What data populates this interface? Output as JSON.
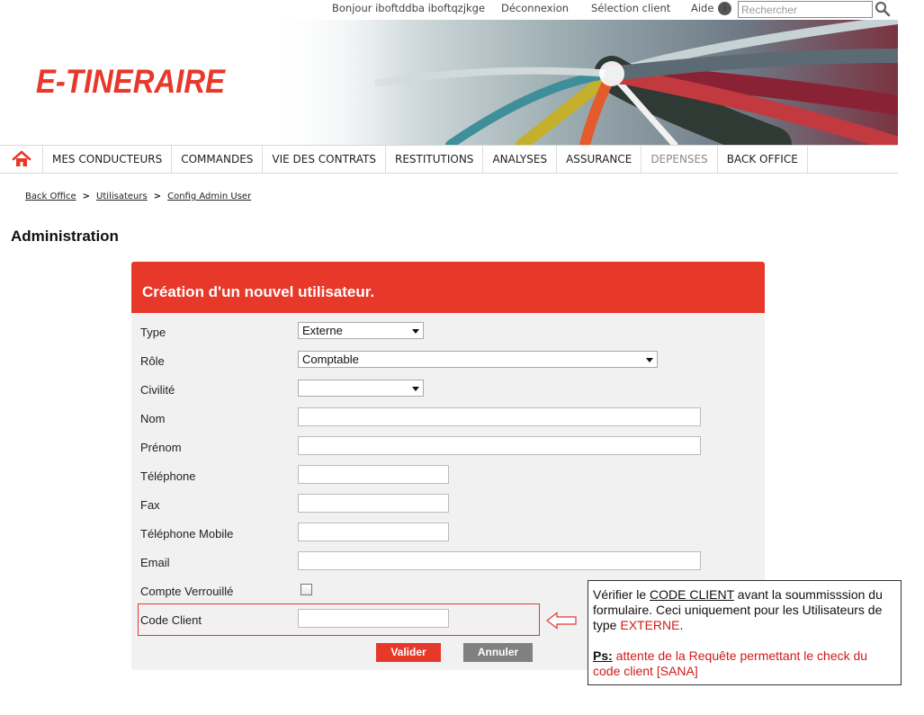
{
  "top_links": {
    "greeting": "Bonjour iboftddba iboftqzjkge",
    "logout": "Déconnexion",
    "client_select": "Sélection client",
    "help": "Aide",
    "search_placeholder": "Rechercher"
  },
  "brand": {
    "logo_text": "E-TINERAIRE",
    "accent": "#e8382a"
  },
  "nav": {
    "home_icon": "home-icon",
    "items": [
      "MES CONDUCTEURS",
      "COMMANDES",
      "VIE DES CONTRATS",
      "RESTITUTIONS",
      "ANALYSES",
      "ASSURANCE",
      "DEPENSES",
      "BACK OFFICE"
    ]
  },
  "breadcrumb": [
    "Back Office",
    "Utilisateurs",
    "Config Admin User"
  ],
  "page_title": "Administration",
  "form": {
    "title": "Création d'un nouvel utilisateur.",
    "labels": {
      "type": "Type",
      "role": "Rôle",
      "civilite": "Civilité",
      "nom": "Nom",
      "prenom": "Prénom",
      "telephone": "Téléphone",
      "fax": "Fax",
      "mobile": "Téléphone Mobile",
      "email": "Email",
      "locked": "Compte Verrouillé",
      "code_client": "Code Client"
    },
    "values": {
      "type": "Externe",
      "role": "Comptable",
      "civilite": "",
      "nom": "",
      "prenom": "",
      "telephone": "",
      "fax": "",
      "mobile": "",
      "email": "",
      "locked": false,
      "code_client": ""
    },
    "buttons": {
      "submit": "Valider",
      "cancel": "Annuler"
    },
    "colors": {
      "header": "#e8382a",
      "panel": "#f1f1f1",
      "cancel_button": "#808080"
    }
  },
  "annotation": {
    "line1_a": "Vérifier le ",
    "line1_b": "CODE CLIENT",
    "line1_c": " avant la soummisssion du formulaire. Ceci uniquement pour les Utilisateurs de type ",
    "line1_d": "EXTERNE",
    "line1_e": ".",
    "ps_label": "Ps",
    "ps_colon": ":",
    "ps_text": " attente de la Requête permettant le check du code client [SANA]",
    "highlight_color": "#d11a1a"
  }
}
